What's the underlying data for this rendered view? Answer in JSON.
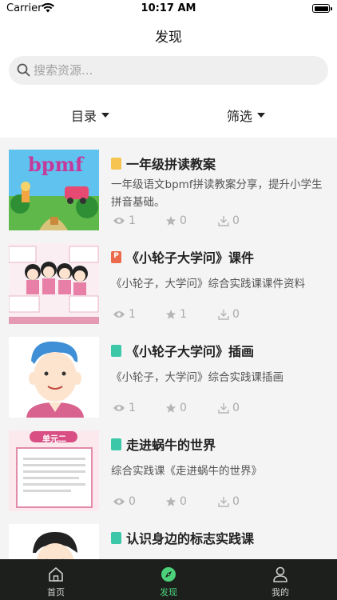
{
  "status": {
    "carrier": "Carrier",
    "time": "10:17 AM"
  },
  "nav": {
    "title": "发现"
  },
  "search": {
    "placeholder": "搜索资源..."
  },
  "filters": {
    "catalog": "目录",
    "filter": "筛选"
  },
  "items": [
    {
      "title": "一年级拼读教案",
      "file_type": "doc-icon",
      "desc": "一年级语文bpmf拼读教案分享，提升小学生拼音基础。",
      "views": "1",
      "stars": "0",
      "downloads": "0",
      "thumb_text": "bpmf"
    },
    {
      "title": "《小轮子大学问》课件",
      "file_type": "ppt-icon",
      "file_glyph": "P",
      "desc": "《小轮子，大学问》综合实践课课件资料",
      "views": "1",
      "stars": "1",
      "downloads": "0"
    },
    {
      "title": "《小轮子大学问》插画",
      "file_type": "image-icon",
      "desc": "《小轮子，大学问》综合实践课插画",
      "views": "1",
      "stars": "0",
      "downloads": "0"
    },
    {
      "title": "走进蜗牛的世界",
      "file_type": "image-icon",
      "desc": "综合实践课《走进蜗牛的世界》",
      "views": "0",
      "stars": "0",
      "downloads": "0",
      "thumb_text": "单元二"
    },
    {
      "title": "认识身边的标志实践课",
      "file_type": "image-icon",
      "desc": "",
      "views": "",
      "stars": "",
      "downloads": ""
    }
  ],
  "tabs": [
    {
      "label": "首页",
      "icon": "home-icon"
    },
    {
      "label": "发现",
      "icon": "discover-icon",
      "active": true
    },
    {
      "label": "我的",
      "icon": "profile-icon"
    }
  ],
  "colors": {
    "accent": "#4cd27a",
    "tabbar_bg": "#1d1f1d",
    "list_bg": "#f4f4f4"
  }
}
